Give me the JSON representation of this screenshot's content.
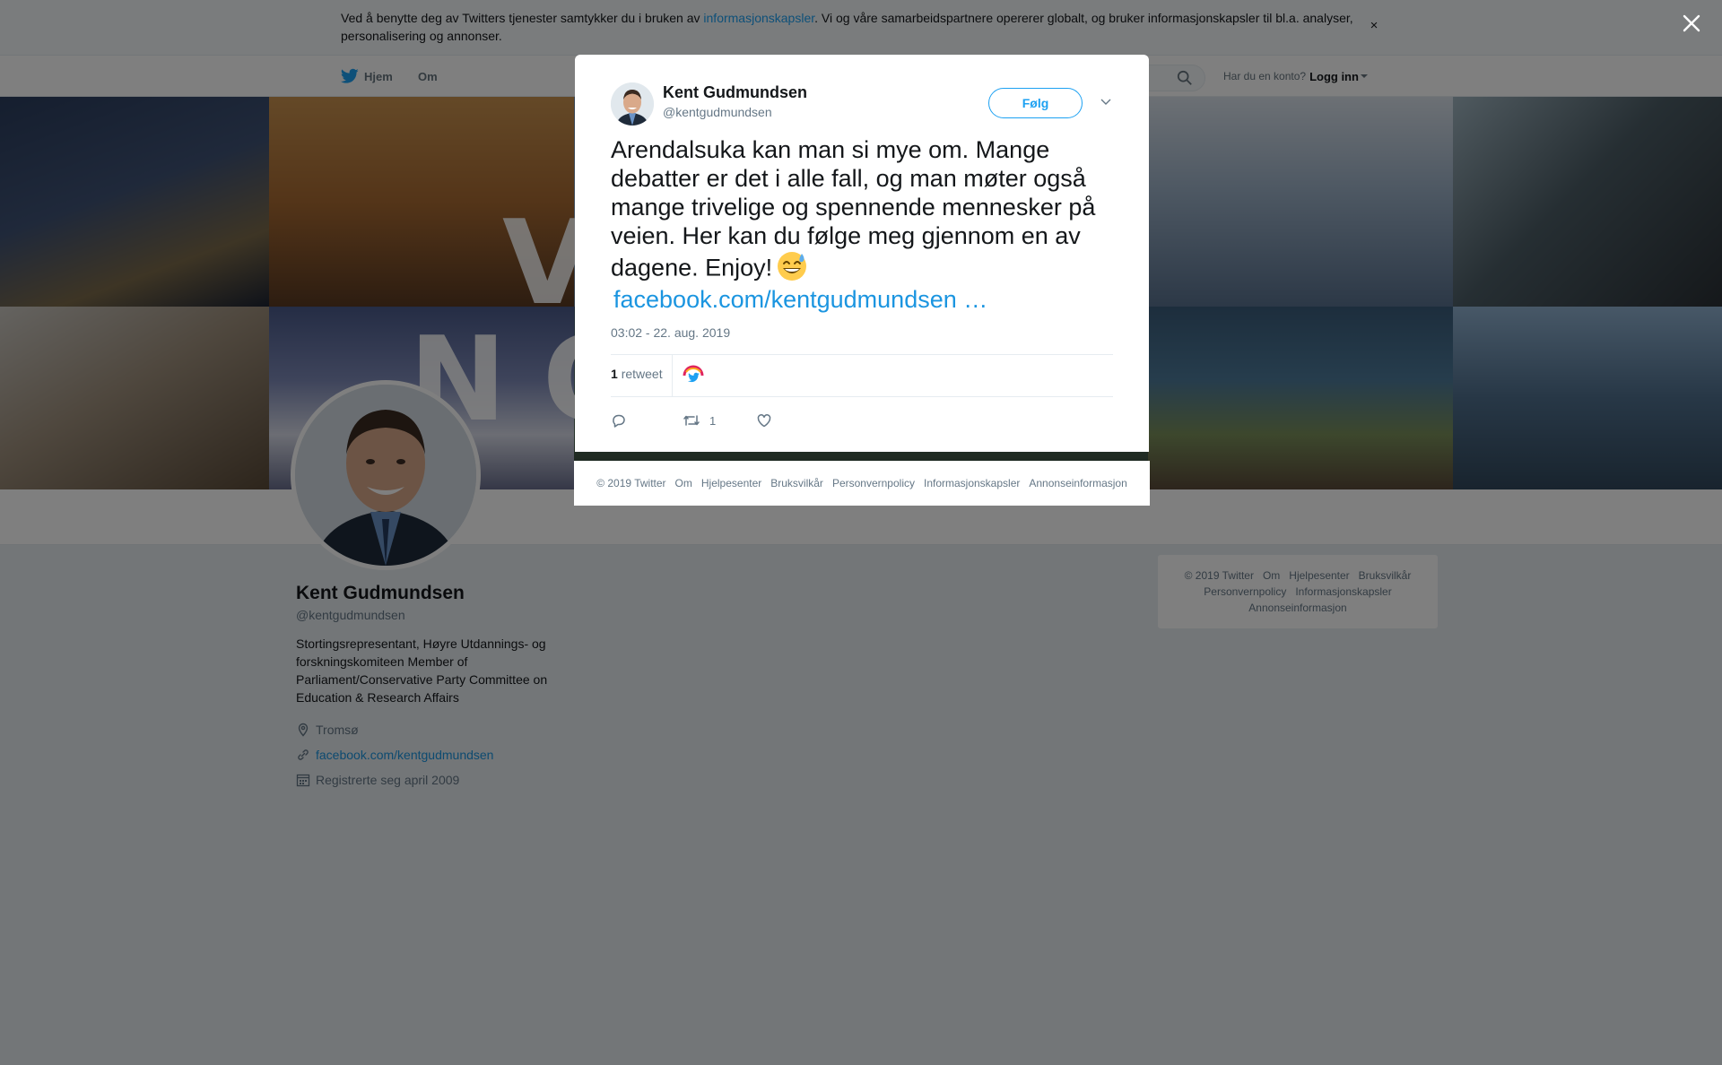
{
  "cookie_bar": {
    "text_before": "Ved å benytte deg av Twitters tjenester samtykker du i bruken av ",
    "link": "informasjonskapsler",
    "text_after": ". Vi og våre samarbeidspartnere opererer globalt, og bruker informasjonskapsler til bl.a. analyser, personalisering og annonser.",
    "close": "×"
  },
  "nav": {
    "home": "Hjem",
    "about": "Om",
    "account_prompt": "Har du en konto?",
    "login": "Logg inn"
  },
  "banner": {
    "word_top": "VÅ",
    "word_bottom": "NORGE"
  },
  "profile": {
    "name": "Kent Gudmundsen",
    "handle": "@kentgudmundsen",
    "bio": "Stortingsrepresentant, Høyre Utdannings- og forskningskomiteen Member of Parliament/Conservative Party Committee on Education & Research Affairs",
    "location": "Tromsø",
    "website": "facebook.com/kentgudmundsen",
    "joined": "Registrerte seg april 2009"
  },
  "side_footer": {
    "line1": [
      "© 2019 Twitter",
      "Om",
      "Hjelpesenter",
      "Bruksvilkår"
    ],
    "line2": [
      "Personvernpolicy",
      "Informasjonskapsler"
    ],
    "line3": [
      "Annonseinformasjon"
    ]
  },
  "tweet": {
    "author_name": "Kent Gudmundsen",
    "author_handle": "@kentgudmundsen",
    "follow_label": "Følg",
    "text": "Arendalsuka kan man si mye om. Mange debatter er det i alle fall, og man møter også mange trivelige og spennende mennesker på veien. Her kan du følge meg gjennom en av dagene. Enjoy!",
    "link": "facebook.com/kentgudmundsen …",
    "timestamp": "03:02 - 22. aug. 2019",
    "retweet_count": "1",
    "retweet_label": "retweet",
    "action_retweet_count": "1"
  },
  "modal_footer": {
    "items": [
      "© 2019 Twitter",
      "Om",
      "Hjelpesenter",
      "Bruksvilkår",
      "Personvernpolicy",
      "Informasjonskapsler",
      "Annonseinformasjon"
    ]
  },
  "colors": {
    "twitter_blue": "#1da1f2",
    "link_blue": "#1b95e0",
    "overlay": "rgba(0,0,0,0.5)"
  }
}
